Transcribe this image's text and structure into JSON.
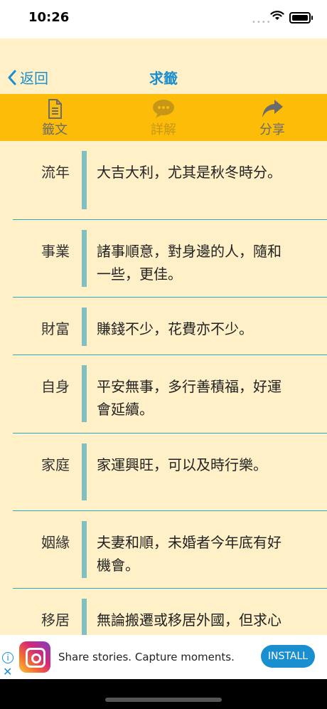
{
  "status": {
    "time": "10:26"
  },
  "nav": {
    "back_label": "返回",
    "title": "求籤"
  },
  "toolbar": {
    "items": [
      {
        "label": "籤文",
        "icon": "document-icon"
      },
      {
        "label": "詳解",
        "icon": "chat-bubble-icon"
      },
      {
        "label": "分享",
        "icon": "share-arrow-icon"
      }
    ]
  },
  "rows": [
    {
      "label": "流年",
      "text": "大吉大利，尤其是秋冬時分。"
    },
    {
      "label": "事業",
      "text": "諸事順意，對身邊的人，隨和一些，更佳。"
    },
    {
      "label": "財富",
      "text": "賺錢不少，花費亦不少。"
    },
    {
      "label": "自身",
      "text": "平安無事，多行善積福，好運會延續。"
    },
    {
      "label": "家庭",
      "text": "家運興旺，可以及時行樂。"
    },
    {
      "label": "姻緣",
      "text": "夫妻和順，未婚者今年底有好機會。"
    },
    {
      "label": "移居",
      "text": "無論搬遷或移居外國，但求心之所安。"
    }
  ],
  "ad": {
    "text": "Share stories. Capture moments.",
    "button": "INSTALL",
    "info": "i",
    "close": "✕"
  },
  "colors": {
    "accent": "#1a8fd0",
    "toolbar": "#fdbc08",
    "background": "#fff0c8",
    "divider": "#2aa9c4",
    "bar": "#80c0c0"
  }
}
